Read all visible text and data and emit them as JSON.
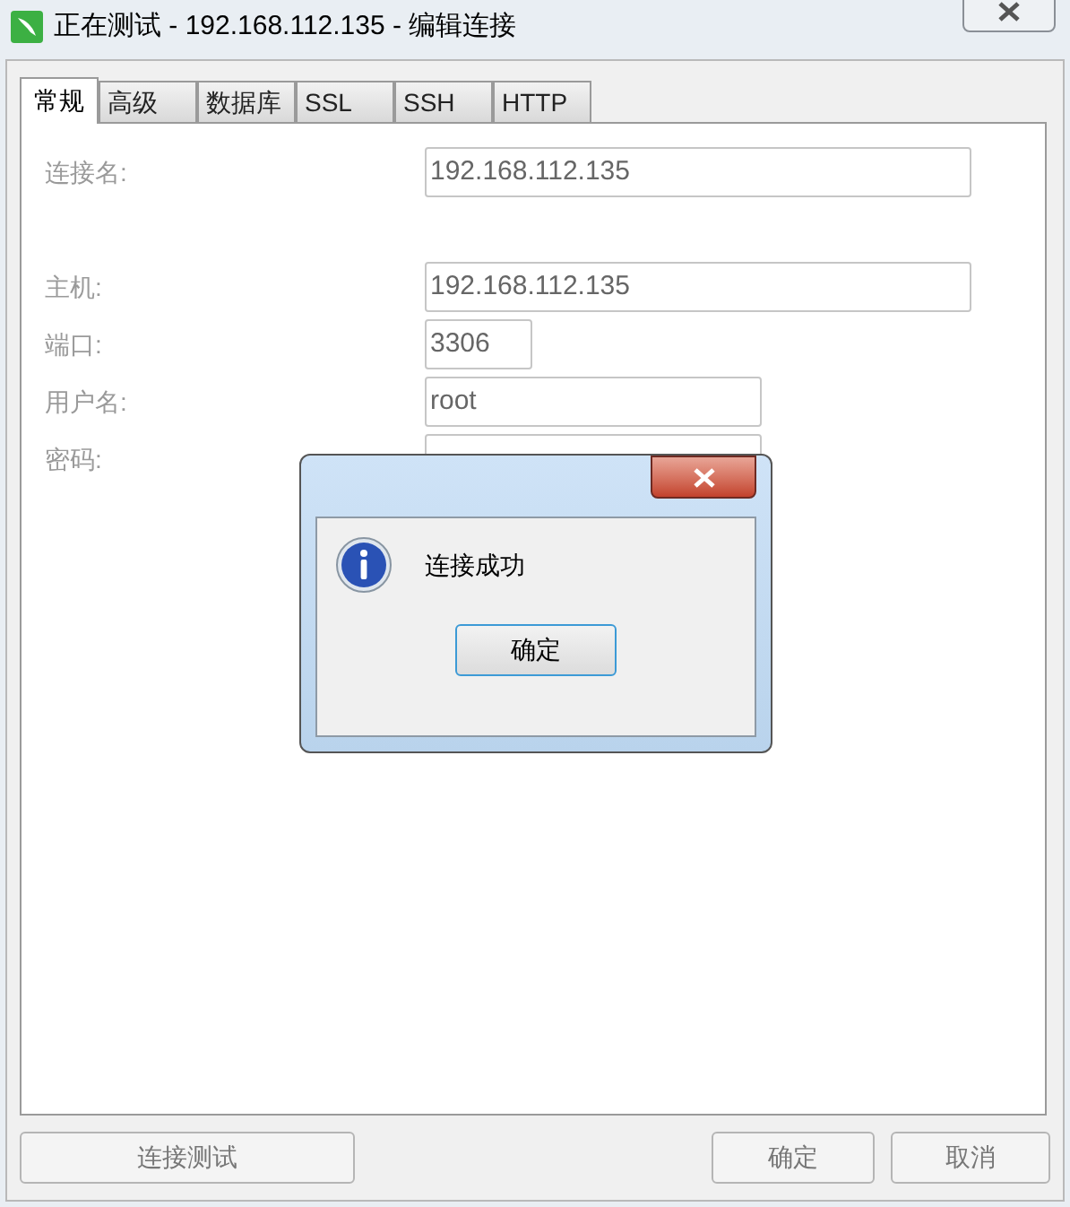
{
  "window": {
    "title": "正在测试 - 192.168.112.135 - 编辑连接"
  },
  "tabs": [
    {
      "label": "常规",
      "selected": true
    },
    {
      "label": "高级",
      "selected": false
    },
    {
      "label": "数据库",
      "selected": false
    },
    {
      "label": "SSL",
      "selected": false
    },
    {
      "label": "SSH",
      "selected": false
    },
    {
      "label": "HTTP",
      "selected": false
    }
  ],
  "fields": [
    {
      "label": "连接名:",
      "value": "192.168.112.135"
    },
    {
      "label": "主机:",
      "value": "192.168.112.135"
    },
    {
      "label": "端口:",
      "value": "3306"
    },
    {
      "label": "用户名:",
      "value": "root"
    },
    {
      "label": "密码:"
    }
  ],
  "dialog": {
    "message": "连接成功",
    "button": "确定"
  },
  "buttons": {
    "test": "连接测试",
    "ok": "确定",
    "cancel": "取消"
  }
}
